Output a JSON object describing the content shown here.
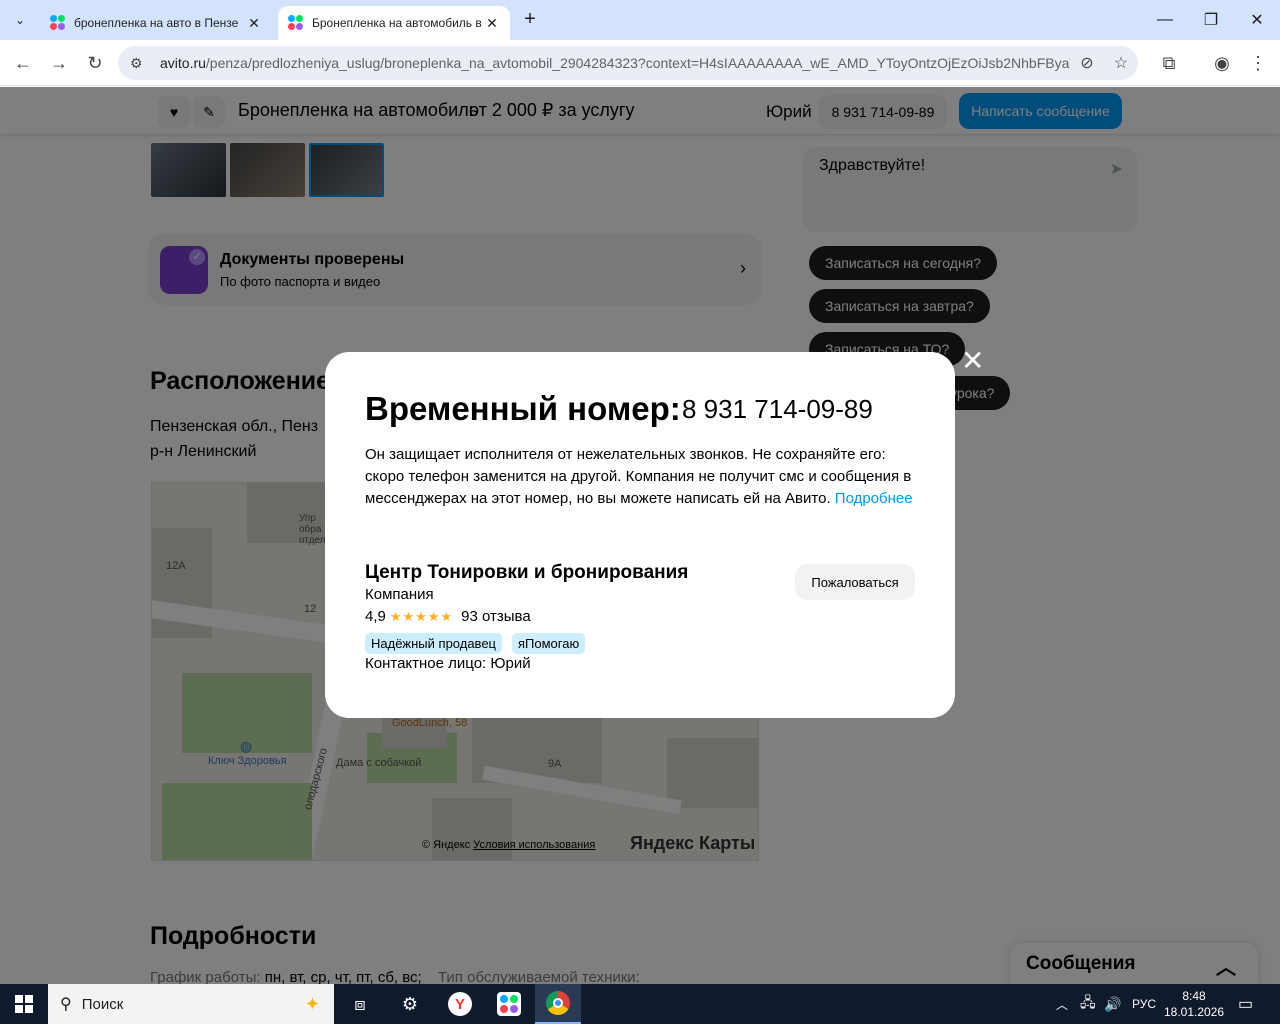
{
  "browser": {
    "tabs": [
      {
        "title": "бронепленка на авто в Пензе"
      },
      {
        "title": "Бронепленка на автомобиль в"
      }
    ],
    "url_domain": "avito.ru",
    "url_rest": "/penza/predlozheniya_uslug/broneplenka_na_avtomobil_2904284323?context=H4sIAAAAAAAA_wE_AMD_YToyOntzOjEzOiJsb2NhbFByaW..."
  },
  "sticky": {
    "title": "Бронепленка на автомобиль",
    "price": "от 2 000 ₽ за услугу",
    "seller": "Юрий",
    "phone": "8 931 714-09-89",
    "write": "Написать сообщение"
  },
  "verify": {
    "title": "Документы проверены",
    "subtitle": "По фото паспорта и видео"
  },
  "location": {
    "heading": "Расположение",
    "line1": "Пензенская обл., Пенз",
    "line2": "р-н Ленинский"
  },
  "map": {
    "labels": [
      "12А",
      "12",
      "9А",
      "Упр обра отдел",
      "GoodLunch, 58",
      "Ключ Здоровья",
      "Дама с собачкой",
      "олодарского"
    ],
    "copyright": "© Яндекс",
    "terms": "Условия использования",
    "brand": "Яндекс Карты"
  },
  "chat": {
    "greeting": "Здравствуйте!",
    "quick_replies": [
      "Записаться на сегодня?",
      "Записаться на завтра?",
      "Записаться на ТО?",
      "урока?"
    ]
  },
  "details": {
    "heading": "Подробности",
    "schedule_label": "График работы:",
    "schedule_value": "пн, вт, ср, чт, пт, сб, вс;",
    "tech_label": "Тип обслуживаемой техники:"
  },
  "messages_panel": {
    "title": "Сообщения"
  },
  "modal": {
    "title": "Временный номер:",
    "phone": "8 931 714-09-89",
    "text": "Он защищает исполнителя от нежелательных звонков. Не сохраняйте его: скоро телефон заменится на другой. Компания не получит смс и сообщения в мессенджерах на этот номер, но вы можете написать ей на Авито.",
    "more_link": "Подробнее",
    "company": "Центр Тонировки и бронирования",
    "company_type": "Компания",
    "rating": "4,9",
    "rating_stars": 5,
    "reviews": "93 отзыва",
    "badges": [
      "Надёжный продавец",
      "яПомогаю"
    ],
    "contact": "Контактное лицо: Юрий",
    "complain": "Пожаловаться"
  },
  "taskbar": {
    "search": "Поиск",
    "lang": "РУС",
    "time": "8:48",
    "date": "18.01.2026"
  },
  "colors": {
    "accent": "#0099f7",
    "badge_bg": "#cdeefe",
    "star": "#ffb021",
    "verify_icon": "#7b3fd0"
  }
}
